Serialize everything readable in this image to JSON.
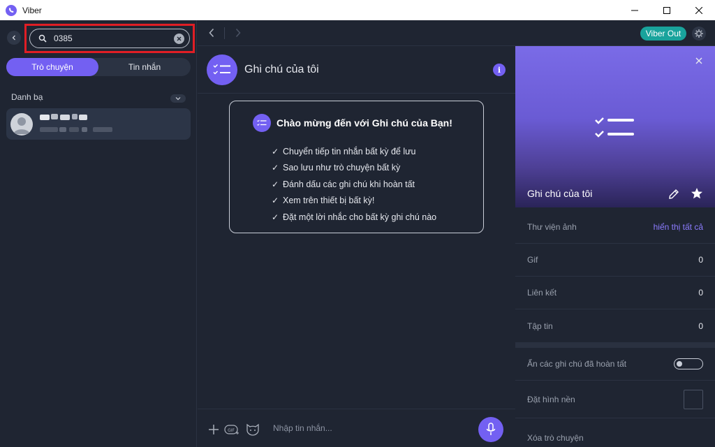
{
  "window": {
    "title": "Viber",
    "controls": [
      "minimize",
      "maximize",
      "close"
    ]
  },
  "sidebar": {
    "search": {
      "value": "0385",
      "placeholder": ""
    },
    "tabs": [
      {
        "label": "Trò chuyện",
        "active": true
      },
      {
        "label": "Tin nhắn",
        "active": false
      }
    ],
    "section_label": "Danh bạ",
    "contacts": [
      {
        "name": "",
        "subtitle": ""
      }
    ]
  },
  "chat": {
    "title": "Ghi chú của tôi",
    "welcome": {
      "title": "Chào mừng đến với Ghi chú của Bạn!",
      "items": [
        "Chuyển tiếp tin nhắn bất kỳ để lưu",
        "Sao lưu như trò chuyện bất kỳ",
        "Đánh dấu các ghi chú khi hoàn tất",
        "Xem trên thiết bị bất kỳ!",
        "Đặt một lời nhắc cho bất kỳ ghi chú nào"
      ]
    },
    "composer": {
      "placeholder": "Nhập tin nhắn..."
    }
  },
  "topbar": {
    "viber_out_label": "Viber Out"
  },
  "info_panel": {
    "title": "Ghi chú của tôi",
    "rows": {
      "gallery": {
        "label": "Thư viện ảnh",
        "action": "hiển thị tất cả"
      },
      "gif": {
        "label": "Gif",
        "count": "0"
      },
      "links": {
        "label": "Liên kết",
        "count": "0"
      },
      "files": {
        "label": "Tập tin",
        "count": "0"
      },
      "hide_done": {
        "label": "Ẩn các ghi chú đã hoàn tất",
        "enabled": false
      },
      "wallpaper": {
        "label": "Đặt hình nền"
      },
      "delete": {
        "label": "Xóa trò chuyện"
      }
    }
  },
  "colors": {
    "accent": "#7360f2",
    "viber_out": "#19a39c",
    "highlight": "#e01e25",
    "background": "#1f2532"
  }
}
